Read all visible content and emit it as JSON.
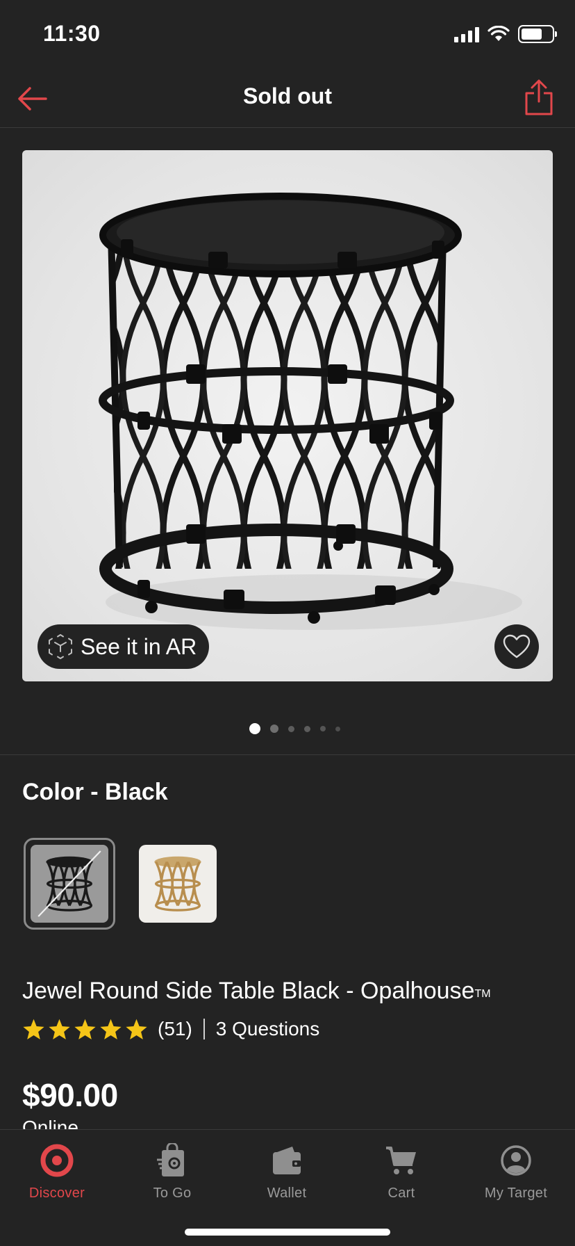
{
  "status_bar": {
    "time": "11:30"
  },
  "header": {
    "title": "Sold out",
    "back_icon": "arrow-left-icon",
    "share_icon": "share-icon"
  },
  "product_image": {
    "ar_label": "See it in AR",
    "ar_icon": "ar-cube-icon",
    "favorite_icon": "heart-icon",
    "page_count": 6,
    "active_page": 1
  },
  "color": {
    "label": "Color - Black",
    "options": [
      {
        "name": "Black",
        "selected": true,
        "sold_out": true
      },
      {
        "name": "Natural",
        "selected": false
      }
    ]
  },
  "product": {
    "title": "Jewel Round Side Table Black - Opalhouse",
    "trademark": "TM",
    "rating": 5,
    "review_count": "(51)",
    "questions": "3 Questions",
    "price": "$90.00",
    "price_note": "Online"
  },
  "tab_bar": {
    "active": "Discover",
    "tabs": [
      {
        "label": "Discover",
        "icon": "target-icon"
      },
      {
        "label": "To Go",
        "icon": "bag-icon"
      },
      {
        "label": "Wallet",
        "icon": "wallet-icon"
      },
      {
        "label": "Cart",
        "icon": "cart-icon"
      },
      {
        "label": "My Target",
        "icon": "profile-icon"
      }
    ]
  },
  "colors": {
    "accent": "#e2474b",
    "background": "#232323",
    "star": "#f5c518"
  }
}
